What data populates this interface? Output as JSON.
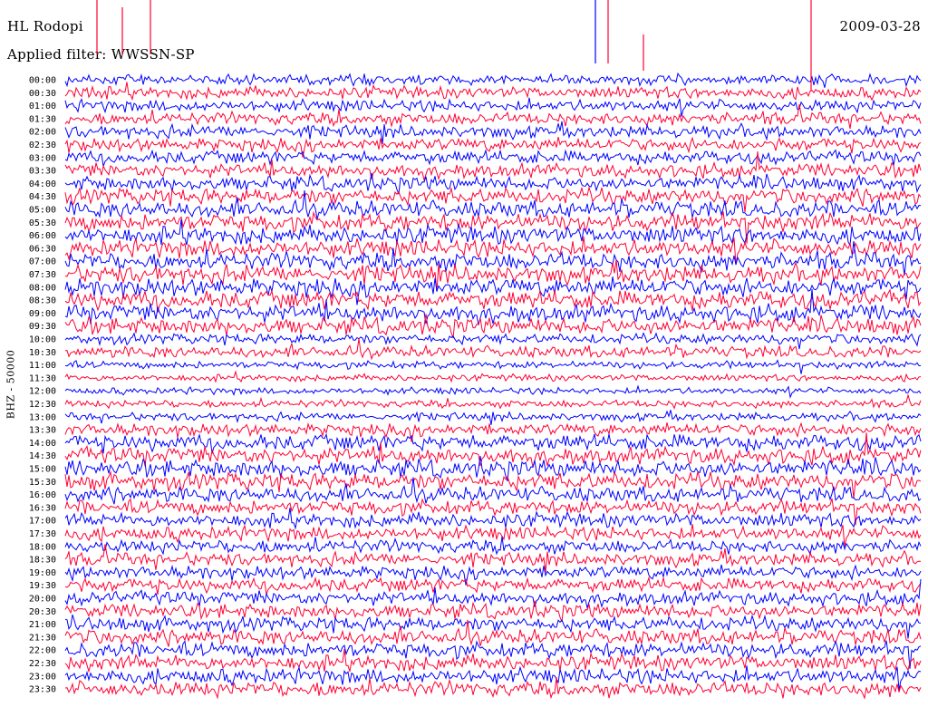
{
  "header": {
    "station": "HL Rodopi",
    "date": "2009-03-28",
    "filter_label": "Applied filter: WWSSN-SP"
  },
  "chart_data": {
    "type": "line",
    "title": "HL Rodopi",
    "subtitle": "Applied filter: WWSSN-SP",
    "date": "2009-03-28",
    "ylabel": "BHZ - 50000",
    "xlabel": "",
    "grid": false,
    "legend": "none",
    "row_colors": [
      "#0000ff",
      "#ff0033"
    ],
    "rows": [
      {
        "time": "00:00",
        "activity": 0.45
      },
      {
        "time": "00:30",
        "activity": 0.55
      },
      {
        "time": "01:00",
        "activity": 0.55
      },
      {
        "time": "01:30",
        "activity": 0.6
      },
      {
        "time": "02:00",
        "activity": 0.6
      },
      {
        "time": "02:30",
        "activity": 0.65
      },
      {
        "time": "03:00",
        "activity": 0.65
      },
      {
        "time": "03:30",
        "activity": 0.7
      },
      {
        "time": "04:00",
        "activity": 0.75
      },
      {
        "time": "04:30",
        "activity": 0.85
      },
      {
        "time": "05:00",
        "activity": 0.9
      },
      {
        "time": "05:30",
        "activity": 0.95
      },
      {
        "time": "06:00",
        "activity": 0.95
      },
      {
        "time": "06:30",
        "activity": 0.95
      },
      {
        "time": "07:00",
        "activity": 0.95
      },
      {
        "time": "07:30",
        "activity": 0.95
      },
      {
        "time": "08:00",
        "activity": 1.0
      },
      {
        "time": "08:30",
        "activity": 1.0
      },
      {
        "time": "09:00",
        "activity": 0.95
      },
      {
        "time": "09:30",
        "activity": 0.9
      },
      {
        "time": "10:00",
        "activity": 0.45
      },
      {
        "time": "10:30",
        "activity": 0.55
      },
      {
        "time": "11:00",
        "activity": 0.25
      },
      {
        "time": "11:30",
        "activity": 0.2
      },
      {
        "time": "12:00",
        "activity": 0.2
      },
      {
        "time": "12:30",
        "activity": 0.25
      },
      {
        "time": "13:00",
        "activity": 0.3
      },
      {
        "time": "13:30",
        "activity": 0.6
      },
      {
        "time": "14:00",
        "activity": 0.85
      },
      {
        "time": "14:30",
        "activity": 0.9
      },
      {
        "time": "15:00",
        "activity": 0.95
      },
      {
        "time": "15:30",
        "activity": 0.95
      },
      {
        "time": "16:00",
        "activity": 0.8
      },
      {
        "time": "16:30",
        "activity": 0.75
      },
      {
        "time": "17:00",
        "activity": 0.7
      },
      {
        "time": "17:30",
        "activity": 0.7
      },
      {
        "time": "18:00",
        "activity": 0.65
      },
      {
        "time": "18:30",
        "activity": 0.65
      },
      {
        "time": "19:00",
        "activity": 0.65
      },
      {
        "time": "19:30",
        "activity": 0.7
      },
      {
        "time": "20:00",
        "activity": 0.7
      },
      {
        "time": "20:30",
        "activity": 0.75
      },
      {
        "time": "21:00",
        "activity": 0.75
      },
      {
        "time": "21:30",
        "activity": 0.8
      },
      {
        "time": "22:00",
        "activity": 0.8
      },
      {
        "time": "22:30",
        "activity": 0.8
      },
      {
        "time": "23:00",
        "activity": 0.8
      },
      {
        "time": "23:30",
        "activity": 0.8
      }
    ]
  }
}
